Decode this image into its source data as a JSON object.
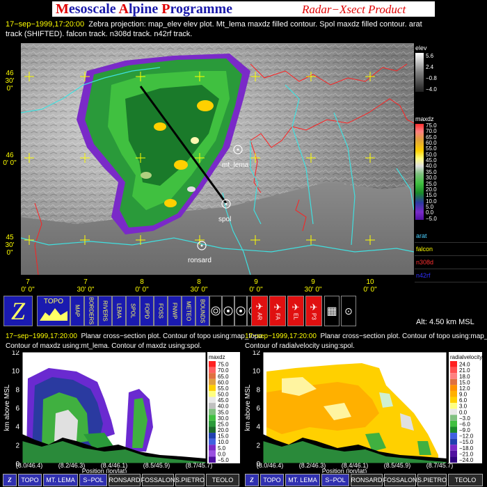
{
  "header": {
    "title_prefix_M": "M",
    "title_part1": "esoscale ",
    "title_prefix_A": "A",
    "title_part2": "lpine ",
    "title_prefix_P": "P",
    "title_part3": "rogramme",
    "subtitle": "Radar−Xsect Product"
  },
  "caption": {
    "timestamp": "17−sep−1999,17:20:00",
    "line1_rest": "Zebra projection: map_elev elev plot.  Mt_lema maxdz filled contour.  Spol maxdz filled contour.   arat",
    "line2": "track (SHIFTED).   falcon track.   n308d track.   n42rf track."
  },
  "map": {
    "lat_labels": [
      {
        "deg": "46",
        "min": "30' 0\""
      },
      {
        "deg": "46",
        "min": "0' 0\""
      },
      {
        "deg": "45",
        "min": "30' 0\""
      }
    ],
    "lon_labels": [
      {
        "deg": "7",
        "min": "0' 0\""
      },
      {
        "deg": "7",
        "min": "30' 0\""
      },
      {
        "deg": "8",
        "min": "0' 0\""
      },
      {
        "deg": "8",
        "min": "30' 0\""
      },
      {
        "deg": "9",
        "min": "0' 0\""
      },
      {
        "deg": "9",
        "min": "30' 0\""
      },
      {
        "deg": "10",
        "min": "0' 0\""
      }
    ],
    "sites": {
      "mt_lema": "mt_lema",
      "spol": "spol",
      "ronsard": "ronsard"
    }
  },
  "legend": {
    "elev_title": "elev",
    "elev_labels": [
      "5.6",
      "2.4",
      "−0.8",
      "−4.0"
    ],
    "maxdz_title": "maxdz",
    "maxdz_labels": [
      "75.0",
      "70.0",
      "65.0",
      "60.0",
      "55.0",
      "50.0",
      "45.0",
      "40.0",
      "35.0",
      "30.0",
      "25.0",
      "20.0",
      "15.0",
      "10.0",
      "5.0",
      "0.0",
      "−5.0"
    ],
    "tracks": [
      {
        "name": "arat",
        "color": "#4ad0ff"
      },
      {
        "name": "falcon",
        "color": "#ffff00"
      },
      {
        "name": "n308d",
        "color": "#ff3030"
      },
      {
        "name": "n42rf",
        "color": "#3030ff"
      }
    ]
  },
  "toolbar": {
    "buttons": [
      "TOPO",
      "MAP",
      "BORDERS",
      "RIVERS",
      "LEMA",
      "SPOL",
      "FOPD",
      "FOSS",
      "FNWP",
      "METEO",
      "BOUNDS",
      "AR",
      "FA",
      "EL",
      "P3"
    ],
    "altitude": "Alt: 4.50 km MSL"
  },
  "left_panel": {
    "caption_time": "17−sep−1999,17:20:00",
    "caption_line1_rest": "Planar cross−section plot.  Contour of topo using:map_topo.",
    "caption_line2": "Contour of maxdz using:mt_lema.  Contour of maxdz using:spol.",
    "ylabel": "km above MSL",
    "xlabel": "Position (lon/lat)",
    "yticks": [
      "12",
      "10",
      "8",
      "6",
      "4",
      "2",
      "0"
    ],
    "xticks": [
      "(8.0/46.4)",
      "(8.2/46.3)",
      "(8.4/46.1)",
      "(8.5/45.9)",
      "(8.7/45.7)"
    ],
    "colorbar_title": "maxdz",
    "colorbar_labels": [
      "75.0",
      "70.0",
      "65.0",
      "60.0",
      "55.0",
      "50.0",
      "45.0",
      "40.0",
      "35.0",
      "30.0",
      "25.0",
      "20.0",
      "15.0",
      "10.0",
      "5.0",
      "0.0",
      "−5.0"
    ]
  },
  "right_panel": {
    "caption_time": "17−sep−1999,17:20:00",
    "caption_line1_rest": "Planar cross−section plot.  Contour of topo using:map_topo.",
    "caption_line2": "Contour of radialvelocity using:spol.",
    "ylabel": "km above MSL",
    "xlabel": "Position (lon/lat)",
    "yticks": [
      "12",
      "10",
      "8",
      "6",
      "4",
      "2",
      "0"
    ],
    "xticks": [
      "(8.0/46.4)",
      "(8.2/46.3)",
      "(8.4/46.1)",
      "(8.5/45.9)",
      "(8.7/45.7)"
    ],
    "colorbar_title": "radialvelocity",
    "colorbar_labels": [
      "24.0",
      "21.0",
      "18.0",
      "15.0",
      "12.0",
      "9.0",
      "6.0",
      "3.0",
      "0.0",
      "−3.0",
      "−6.0",
      "−9.0",
      "−12.0",
      "−15.0",
      "−18.0",
      "−21.0",
      "−24.0"
    ]
  },
  "bottom_bar_left": [
    "TOPO",
    "MT. LEMA",
    "S−POL",
    "RONSARD",
    "FOSSALON",
    "S.PIETRO",
    "TEOLO"
  ],
  "bottom_bar_right": [
    "TOPO",
    "MT. LEMA",
    "S−POL",
    "RONSARD",
    "FOSSALON",
    "S.PIETRO",
    "TEOLO"
  ]
}
